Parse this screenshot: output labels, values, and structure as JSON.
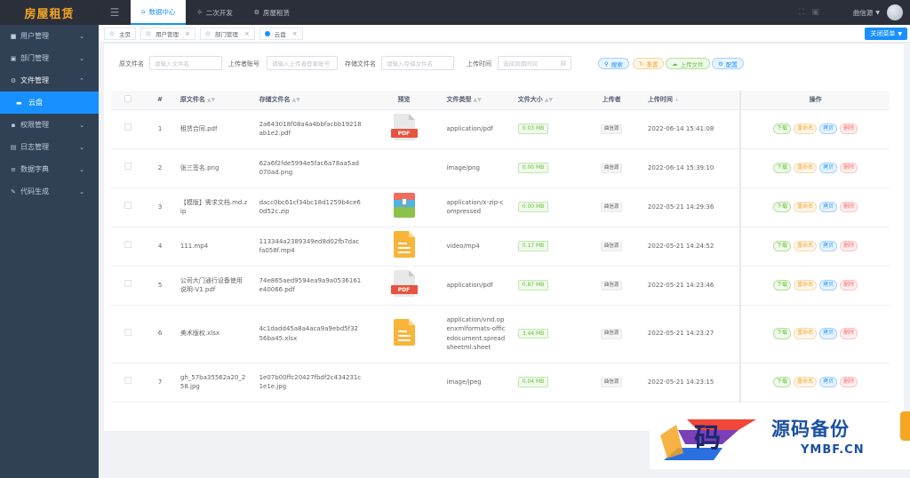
{
  "app": {
    "logo": "房屋租赁"
  },
  "sidebar": {
    "items": [
      {
        "label": "用户管理",
        "icon": "user-icon"
      },
      {
        "label": "部门管理",
        "icon": "document-icon"
      },
      {
        "label": "文件管理",
        "icon": "gear-icon"
      },
      {
        "label": "云盘",
        "icon": "folder-icon"
      },
      {
        "label": "权限管理",
        "icon": "lock-icon"
      },
      {
        "label": "日志管理",
        "icon": "calendar-icon"
      },
      {
        "label": "数据字典",
        "icon": "list-icon"
      },
      {
        "label": "代码生成",
        "icon": "edit-icon"
      }
    ]
  },
  "header": {
    "tabs": [
      {
        "label": "数据中心",
        "icon": "home-icon"
      },
      {
        "label": "二次开发",
        "icon": "bulb-icon"
      },
      {
        "label": "房屋租赁",
        "icon": "gear-icon"
      }
    ],
    "user": "曲信源"
  },
  "tags": [
    "主页",
    "用户管理",
    "部门管理",
    "云盘"
  ],
  "close_menu": "关闭菜单",
  "search": {
    "f1_label": "原文件名",
    "f1_ph": "请输入文件名",
    "f2_label": "上传者账号",
    "f2_ph": "请输入上传者登录账号",
    "f3_label": "存储文件名",
    "f3_ph": "请输入存储文件名",
    "f4_label": "上传时间",
    "f4_ph": "选择到期时间",
    "btn_search": "搜索",
    "btn_reset": "重置",
    "btn_upload": "上传文件",
    "btn_config": "配置"
  },
  "table": {
    "headers": {
      "index": "#",
      "orig": "原文件名",
      "stored": "存储文件名",
      "preview": "预览",
      "type": "文件类型",
      "size": "文件大小",
      "uploader": "上传者",
      "time": "上传时间",
      "ops": "操作"
    },
    "op_labels": {
      "download": "下载",
      "rename": "重命名",
      "copy": "拷贝",
      "delete": "删除"
    },
    "rows": [
      {
        "index": "1",
        "orig": "租赁合同.pdf",
        "stored": "2a643018f08a4a4bbfacbb19218ab1e2.pdf",
        "preview": "pdf",
        "type": "application/pdf",
        "size": "0.03 MB",
        "uploader": "曲信源",
        "time": "2022-06-14 15:41:08"
      },
      {
        "index": "2",
        "orig": "张三签名.png",
        "stored": "62a6f2fde5994e5fac6a78aa5ad070ad.png",
        "preview": "none",
        "type": "image/png",
        "size": "0.00 MB",
        "uploader": "曲信源",
        "time": "2022-06-14 15:39:10"
      },
      {
        "index": "3",
        "orig": "【模版】需求文档.md.zip",
        "stored": "dacc0bc61cf34bc18d1259b4ce60d52c.zip",
        "preview": "zip",
        "type": "application/x-zip-compressed",
        "size": "0.00 MB",
        "uploader": "曲信源",
        "time": "2022-05-21 14:29:36"
      },
      {
        "index": "4",
        "orig": "111.mp4",
        "stored": "113344a2389349ed8d02fb7dacfa058f.mp4",
        "preview": "doc",
        "type": "video/mp4",
        "size": "0.17 MB",
        "uploader": "曲信源",
        "time": "2022-05-21 14:24:52"
      },
      {
        "index": "5",
        "orig": "公司大门通行设备使用说明-V1.pdf",
        "stored": "74e865aed9594ea9a9a0536161e40066.pdf",
        "preview": "pdf",
        "type": "application/pdf",
        "size": "0.87 MB",
        "uploader": "曲信源",
        "time": "2022-05-21 14:23:46"
      },
      {
        "index": "6",
        "orig": "美术版权.xlsx",
        "stored": "4c1dadd45a8a4aca9a9ebd5f3256ba45.xlsx",
        "preview": "doc",
        "type": "application/vnd.openxmlformats-officedocument.spreadsheetml.sheet",
        "size": "3.44 MB",
        "uploader": "曲信源",
        "time": "2022-05-21 14:23:27"
      },
      {
        "index": "7",
        "orig": "gh_57ba35562a20_258.jpg",
        "stored": "1e07b00ffc20427fbdf2c434231c1e1e.jpg",
        "preview": "none",
        "type": "image/jpeg",
        "size": "0.04 MB",
        "uploader": "曲信源",
        "time": "2022-05-21 14:23:15"
      }
    ]
  },
  "watermark": {
    "char": "码",
    "title": "源码备份",
    "sub": "YMBF.CN"
  }
}
